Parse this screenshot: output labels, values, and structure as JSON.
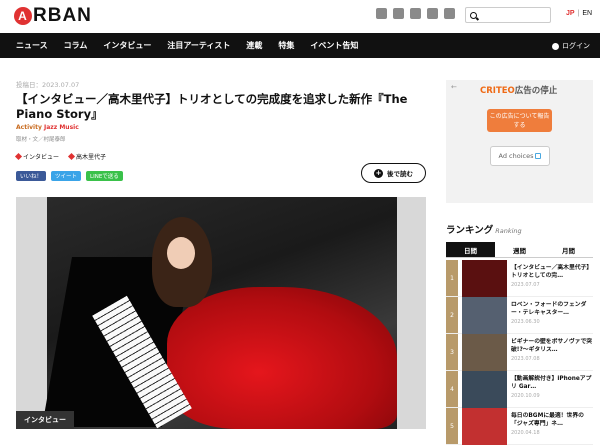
{
  "header": {
    "logo_text": "RBAN",
    "logo_mark": "A",
    "social_icons": [
      "facebook-icon",
      "twitter-icon",
      "instagram-icon",
      "youtube-icon",
      "rss-icon"
    ],
    "lang_jp": "JP",
    "lang_sep": "|",
    "lang_en": "EN"
  },
  "nav": {
    "items": [
      "ニュース",
      "コラム",
      "インタビュー",
      "注目アーティスト",
      "連載",
      "特集",
      "イベント告知"
    ],
    "login": "ログイン"
  },
  "article": {
    "date": "投稿日：2023.07.07",
    "title": "【インタビュー／高木里代子】トリオとしての完成度を追求した新作『The Piano Story』",
    "activity_prefix": "Activity ",
    "activity_genre": "Jazz Music",
    "credit": "取材・文／村尾泰郎",
    "tags": [
      "インタビュー",
      "高木里代子"
    ],
    "share_fb": "いいね！",
    "share_tw": "ツイート",
    "share_line": "LINEで送る",
    "read_later": "後で読む",
    "photo_label": "インタビュー"
  },
  "ad": {
    "back": "←",
    "brand": "CRITEO",
    "title": "広告の停止",
    "button": "この広告について報告する",
    "adchoices": "Ad choices"
  },
  "ranking": {
    "title": "ランキング",
    "subtitle": "Ranking",
    "tabs": [
      "日間",
      "週間",
      "月間"
    ],
    "items": [
      {
        "num": "1",
        "title": "【インタビュー／高木里代子】トリオとしての完…",
        "date": "2023.07.07"
      },
      {
        "num": "2",
        "title": "ロベン・フォードのフェンダー・テレキャスター…",
        "date": "2023.06.30"
      },
      {
        "num": "3",
        "title": "ビギナーの壁をボサノヴァで突破!?～ギタリス…",
        "date": "2023.07.08"
      },
      {
        "num": "4",
        "title": "【動画解説付き】iPhoneアプリ Gar…",
        "date": "2020.10.09"
      },
      {
        "num": "5",
        "title": "毎日のBGMに最適！世界の「ジャズ専門」ネ…",
        "date": "2020.04.18"
      }
    ]
  },
  "colors": {
    "accent": "#e03232",
    "nav_bg": "#111111",
    "ad_orange": "#ef7d3c"
  }
}
